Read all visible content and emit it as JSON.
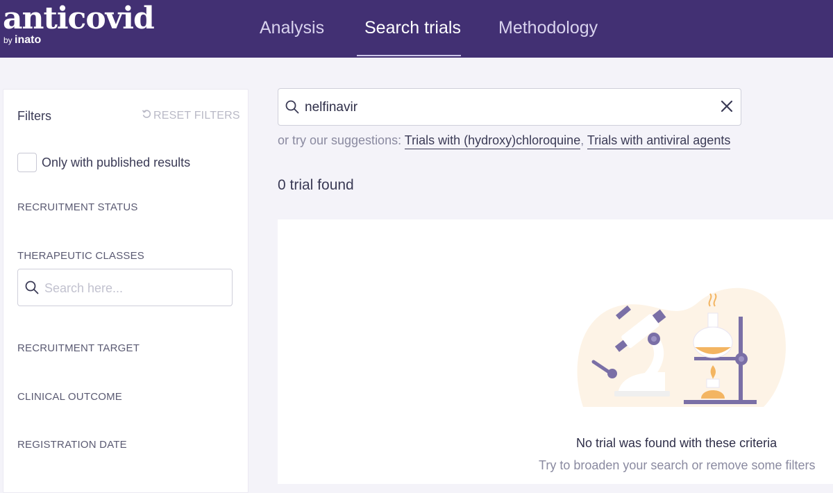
{
  "brand": {
    "name": "anticovid",
    "by": "by",
    "by_company": "inato"
  },
  "nav": {
    "tabs": [
      {
        "label": "Analysis"
      },
      {
        "label": "Search trials",
        "active": true
      },
      {
        "label": "Methodology"
      }
    ]
  },
  "sidebar": {
    "title": "Filters",
    "reset_label": "RESET FILTERS",
    "published_only_label": "Only with published results",
    "published_only_checked": false,
    "sections": {
      "recruitment_status": "RECRUITMENT STATUS",
      "therapeutic_classes": "THERAPEUTIC CLASSES",
      "recruitment_target": "RECRUITMENT TARGET",
      "clinical_outcome": "CLINICAL OUTCOME",
      "registration_date": "REGISTRATION DATE"
    },
    "therapeutic_search_placeholder": "Search here..."
  },
  "search": {
    "value": "nelfinavir",
    "suggestions_prefix": "or try our suggestions:",
    "suggestions": [
      "Trials with (hydroxy)chloroquine",
      "Trials with antiviral agents"
    ],
    "separator": ","
  },
  "results": {
    "count_text": "0 trial found",
    "empty_title": "No trial was found with these criteria",
    "empty_subtitle": "Try to broaden your search or remove some filters"
  },
  "colors": {
    "header_bg": "#423073",
    "page_bg": "#f4f3f9",
    "illustration_purple": "#7a6fa6",
    "illustration_orange": "#f3b562",
    "illustration_blob": "#fdf3e6"
  },
  "icons": [
    "search-icon",
    "close-icon",
    "reset-icon",
    "microscope-icon",
    "lab-flask-icon"
  ]
}
